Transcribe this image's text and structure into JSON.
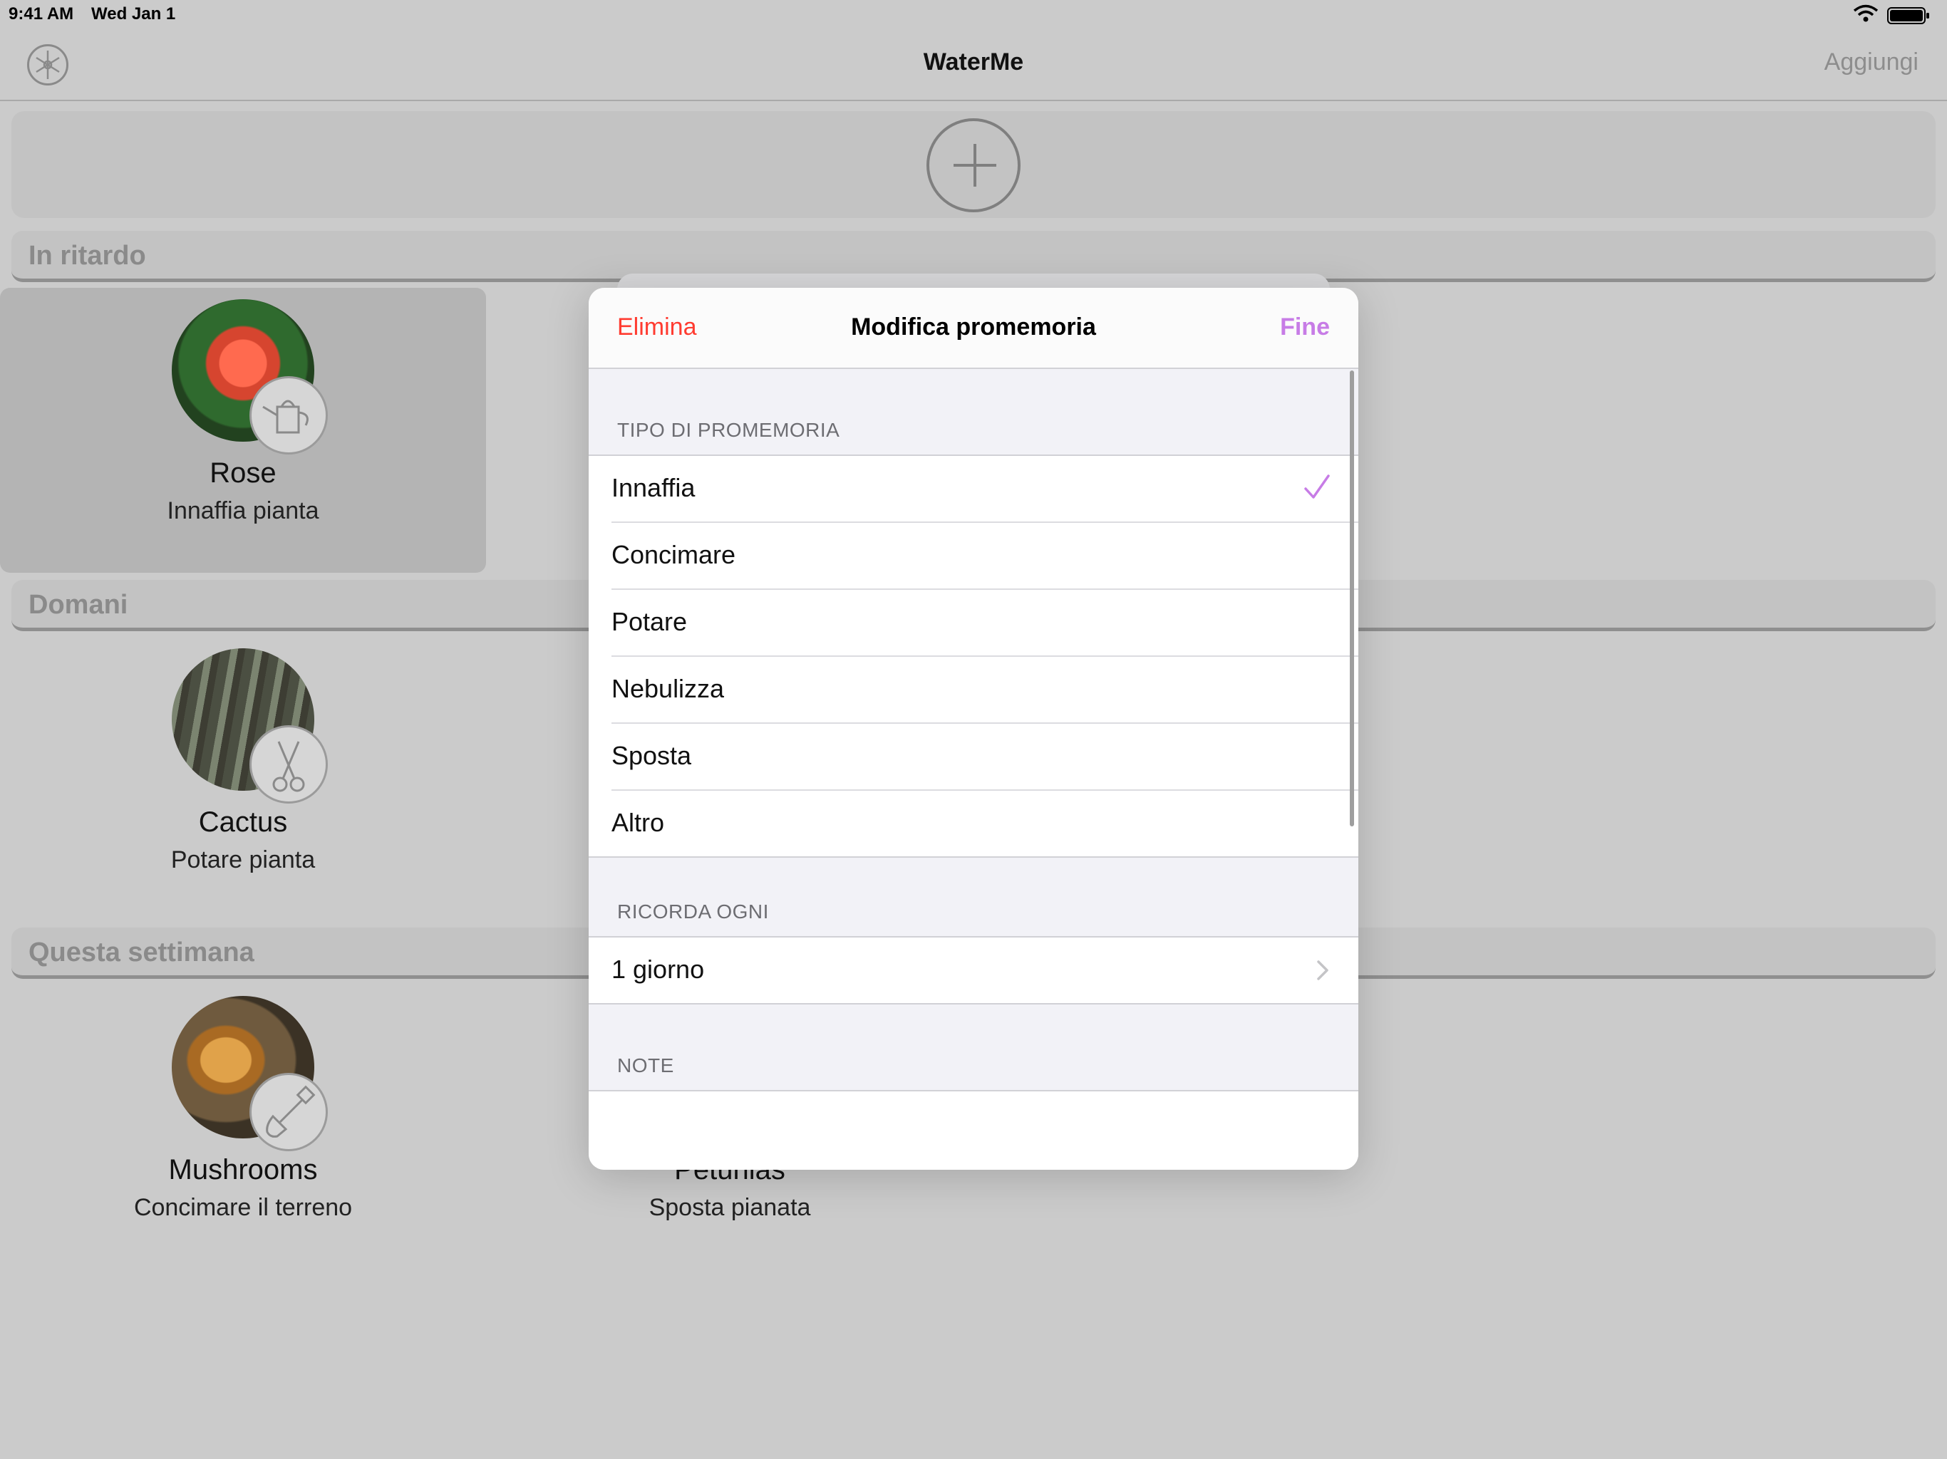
{
  "status": {
    "time": "9:41 AM",
    "date": "Wed Jan 1"
  },
  "navbar": {
    "title": "WaterMe",
    "add_label": "Aggiungi"
  },
  "sections": [
    {
      "title": "In ritardo"
    },
    {
      "title": "Domani"
    },
    {
      "title": "Questa settimana"
    }
  ],
  "plants": [
    {
      "name": "Rose",
      "task": "Innaffia pianta",
      "badge_icon": "watering-can-icon"
    },
    {
      "name": "Cactus",
      "task": "Potare pianta",
      "badge_icon": "scissors-icon"
    },
    {
      "name": "Mushrooms",
      "task": "Concimare il terreno",
      "badge_icon": "shovel-icon"
    },
    {
      "name": "Petunias",
      "task": "Sposta pianata"
    }
  ],
  "modal": {
    "delete_label": "Elimina",
    "title": "Modifica promemoria",
    "done_label": "Fine",
    "reminder_type_header": "TIPO DI PROMEMORIA",
    "reminder_types": [
      "Innaffia",
      "Concimare",
      "Potare",
      "Nebulizza",
      "Sposta",
      "Altro"
    ],
    "selected_type": "Innaffia",
    "interval_header": "RICORDA OGNI",
    "interval_value": "1 giorno",
    "notes_header": "NOTE"
  },
  "colors": {
    "accent": "#c77ce6",
    "destructive": "#ff3b30",
    "background": "#cbcbcb"
  }
}
